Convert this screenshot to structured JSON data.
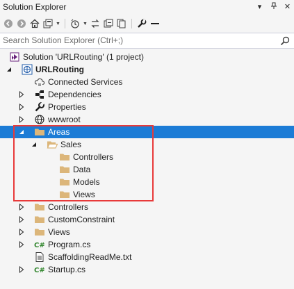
{
  "window": {
    "title": "Solution Explorer",
    "controls": [
      "chevron-down-icon",
      "pin-icon",
      "close-icon"
    ]
  },
  "toolbar": {
    "buttons": [
      "back-icon",
      "forward-icon",
      "home-icon",
      "switch-views-icon",
      "pending-changes-icon",
      "sync-icon",
      "collapse-all-icon",
      "show-all-files-icon",
      "properties-icon",
      "preview-icon"
    ]
  },
  "search": {
    "placeholder": "Search Solution Explorer (Ctrl+;)",
    "value": ""
  },
  "colors": {
    "selection": "#1c7cd6",
    "highlight_border": "#e83a3a",
    "folder": "#dcb67a",
    "csharp": "#388a34"
  },
  "tree": {
    "items": [
      {
        "label": "Solution 'URLRouting' (1 project)",
        "icon": "solution-icon",
        "level": 0,
        "expander": "none"
      },
      {
        "label": "URLRouting",
        "icon": "web-project-icon",
        "level": 0,
        "expander": "expanded",
        "bold": true
      },
      {
        "label": "Connected Services",
        "icon": "connected-services-icon",
        "level": 1,
        "expander": "none"
      },
      {
        "label": "Dependencies",
        "icon": "dependencies-icon",
        "level": 1,
        "expander": "collapsed"
      },
      {
        "label": "Properties",
        "icon": "wrench-icon",
        "level": 1,
        "expander": "collapsed"
      },
      {
        "label": "wwwroot",
        "icon": "globe-icon",
        "level": 1,
        "expander": "collapsed"
      },
      {
        "label": "Areas",
        "icon": "folder-icon",
        "level": 1,
        "expander": "expanded",
        "selected": true
      },
      {
        "label": "Sales",
        "icon": "folder-open-icon",
        "level": 2,
        "expander": "expanded"
      },
      {
        "label": "Controllers",
        "icon": "folder-icon",
        "level": 3,
        "expander": "none"
      },
      {
        "label": "Data",
        "icon": "folder-icon",
        "level": 3,
        "expander": "none"
      },
      {
        "label": "Models",
        "icon": "folder-icon",
        "level": 3,
        "expander": "none"
      },
      {
        "label": "Views",
        "icon": "folder-icon",
        "level": 3,
        "expander": "none"
      },
      {
        "label": "Controllers",
        "icon": "folder-icon",
        "level": 1,
        "expander": "collapsed"
      },
      {
        "label": "CustomConstraint",
        "icon": "folder-icon",
        "level": 1,
        "expander": "collapsed"
      },
      {
        "label": "Views",
        "icon": "folder-icon",
        "level": 1,
        "expander": "collapsed"
      },
      {
        "label": "Program.cs",
        "icon": "csharp-file-icon",
        "level": 1,
        "expander": "collapsed"
      },
      {
        "label": "ScaffoldingReadMe.txt",
        "icon": "text-file-icon",
        "level": 1,
        "expander": "none"
      },
      {
        "label": "Startup.cs",
        "icon": "csharp-file-icon",
        "level": 1,
        "expander": "collapsed"
      }
    ]
  }
}
